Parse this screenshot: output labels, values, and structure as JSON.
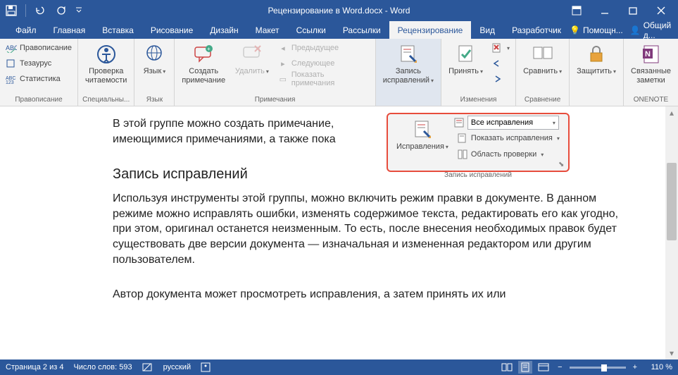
{
  "app": {
    "title": "Рецензирование в Word.docx - Word"
  },
  "tabs": {
    "file": "Файл",
    "home": "Главная",
    "insert": "Вставка",
    "draw": "Рисование",
    "design": "Дизайн",
    "layout": "Макет",
    "refs": "Ссылки",
    "mail": "Рассылки",
    "review": "Рецензирование",
    "view": "Вид",
    "dev": "Разработчик",
    "help": "Помощн...",
    "share": "Общий д..."
  },
  "ribbon": {
    "g1": {
      "name": "Правописание",
      "spell": "Правописание",
      "thes": "Тезаурус",
      "stat": "Статистика"
    },
    "g2": {
      "name": "Специальны...",
      "read": "Проверка\nчитаемости"
    },
    "g3": {
      "name": "Язык",
      "lang": "Язык"
    },
    "g4": {
      "name": "Примечания",
      "new": "Создать\nпримечание",
      "del": "Удалить",
      "prev": "Предыдущее",
      "next": "Следующее",
      "show": "Показать примечания"
    },
    "g5": {
      "name": "",
      "track": "Запись\nисправлений"
    },
    "g6": {
      "name": "Изменения",
      "accept": "Принять"
    },
    "g7": {
      "name": "Сравнение",
      "compare": "Сравнить"
    },
    "g8": {
      "name": "",
      "protect": "Защитить"
    },
    "g9": {
      "name": "ONENOTE",
      "linked": "Связанные\nзаметки"
    }
  },
  "callout": {
    "name": "Запись исправлений",
    "trackBtn": "Исправления",
    "display": "Все исправления",
    "showMarkup": "Показать исправления",
    "reviewPane": "Область проверки"
  },
  "doc": {
    "p1": "В этой группе можно создать примечание,",
    "p1b": "имеющимися примечаниями, а также пока",
    "h2": "Запись исправлений",
    "p2": "Используя инструменты этой группы, можно включить режим правки в документе. В данном режиме можно исправлять ошибки, изменять содержимое текста, редактировать его как угодно, при этом, оригинал останется неизменным. То есть, после внесения необходимых правок будет существовать две версии документа — изначальная и измененная редактором или другим пользователем.",
    "p3": "Автор документа может просмотреть исправления, а затем принять их или"
  },
  "status": {
    "page": "Страница 2 из 4",
    "words": "Число слов: 593",
    "lang": "русский",
    "zoom": "110 %"
  }
}
